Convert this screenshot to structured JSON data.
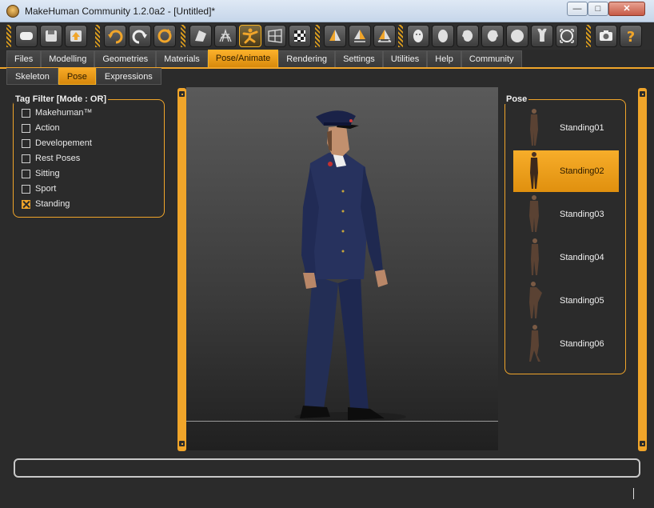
{
  "window": {
    "title": "MakeHuman Community 1.2.0a2 - [Untitled]*",
    "min_glyph": "—",
    "max_glyph": "□",
    "close_glyph": "✕"
  },
  "toolbar": {
    "groups": [
      [
        "new-icon",
        "save-icon",
        "export-icon"
      ],
      [
        "undo-icon",
        "redo-icon",
        "reset-icon"
      ],
      [
        "smooth-icon",
        "wireframe-icon",
        "pose-icon",
        "background-icon",
        "grid-icon"
      ],
      [
        "front-view-icon",
        "side-view-icon",
        "top-view-icon"
      ],
      [
        "face-icon",
        "head-icon",
        "left-view-icon",
        "right-view-icon",
        "back-view-icon",
        "top-cam-icon",
        "reset-camera-icon"
      ],
      [
        "screenshot-icon",
        "help-icon"
      ]
    ],
    "active": "pose-icon",
    "accent": "#f0a52a"
  },
  "tabs": [
    "Files",
    "Modelling",
    "Geometries",
    "Materials",
    "Pose/Animate",
    "Rendering",
    "Settings",
    "Utilities",
    "Help",
    "Community"
  ],
  "active_tab": "Pose/Animate",
  "subtabs": [
    "Skeleton",
    "Pose",
    "Expressions"
  ],
  "active_subtab": "Pose",
  "tag_filter": {
    "title": "Tag Filter [Mode : OR]",
    "items": [
      {
        "label": "Makehuman™",
        "checked": false
      },
      {
        "label": "Action",
        "checked": false
      },
      {
        "label": "Developement",
        "checked": false
      },
      {
        "label": "Rest Poses",
        "checked": false
      },
      {
        "label": "Sitting",
        "checked": false
      },
      {
        "label": "Sport",
        "checked": false
      },
      {
        "label": "Standing",
        "checked": true
      }
    ]
  },
  "pose_panel": {
    "title": "Pose",
    "items": [
      {
        "label": "Standing01",
        "selected": false
      },
      {
        "label": "Standing02",
        "selected": true
      },
      {
        "label": "Standing03",
        "selected": false
      },
      {
        "label": "Standing04",
        "selected": false
      },
      {
        "label": "Standing05",
        "selected": false
      },
      {
        "label": "Standing06",
        "selected": false
      }
    ]
  },
  "status": {
    "text": ""
  }
}
